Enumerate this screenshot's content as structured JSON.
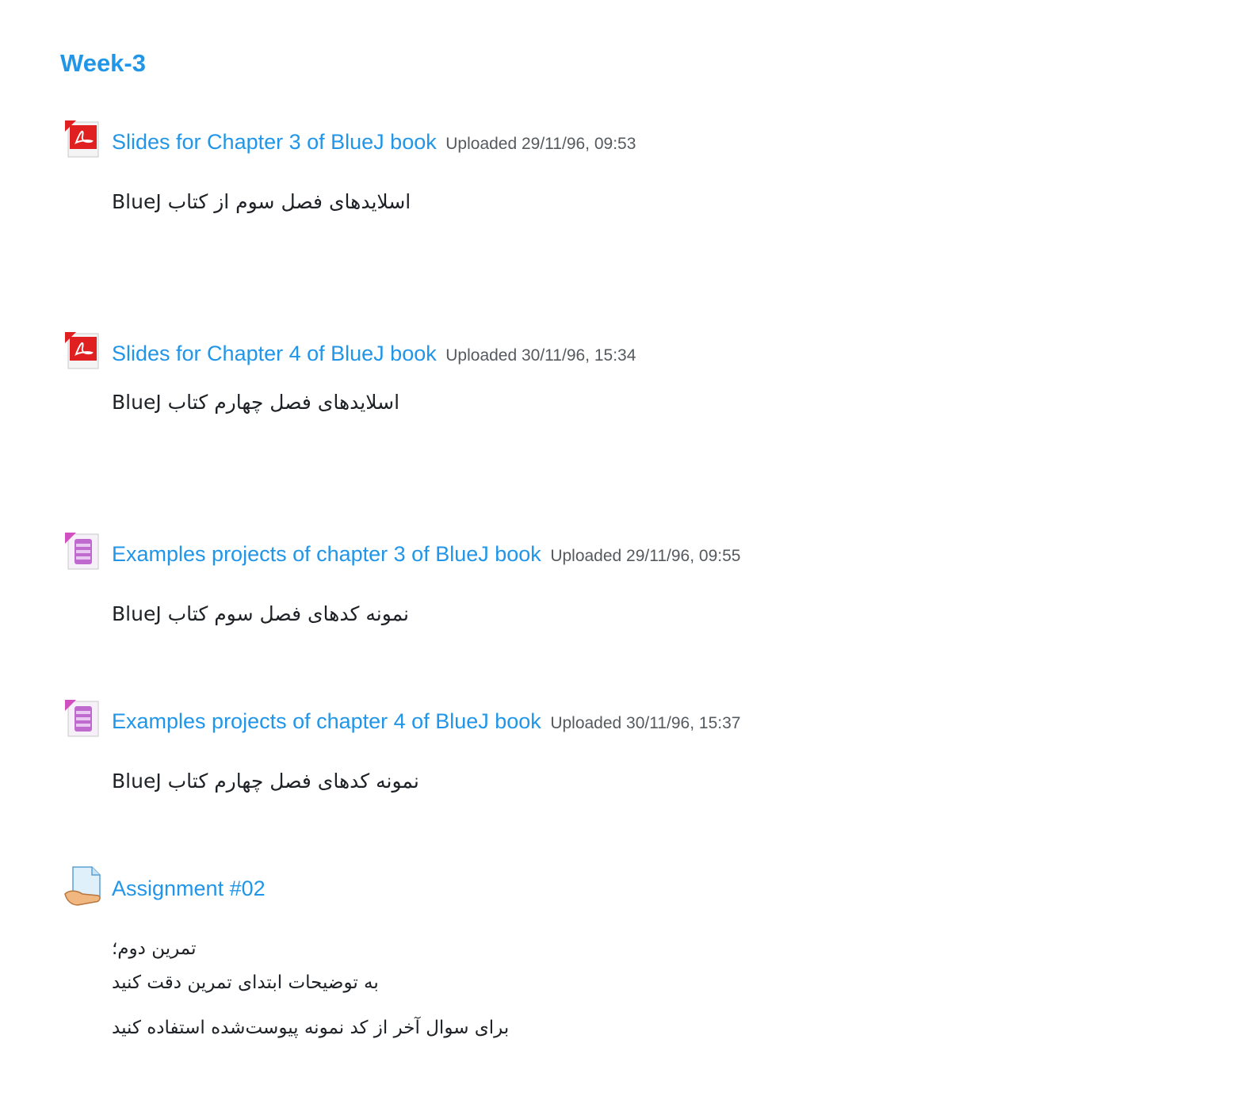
{
  "section": {
    "title": "Week-3"
  },
  "activities": [
    {
      "type_icon": "pdf-icon",
      "title": "Slides for Chapter 3 of BlueJ book",
      "uploaded": "Uploaded 29/11/96, 09:53",
      "description": "اسلایدهای فصل سوم از کتاب BlueJ"
    },
    {
      "type_icon": "pdf-icon",
      "title": "Slides for Chapter 4 of BlueJ book",
      "uploaded": "Uploaded 30/11/96, 15:34",
      "description": "اسلایدهای فصل چهارم کتاب BlueJ"
    },
    {
      "type_icon": "archive-icon",
      "title": "Examples projects of chapter 3 of BlueJ book",
      "uploaded": "Uploaded 29/11/96, 09:55",
      "description": "نمونه کدهای فصل سوم کتاب BlueJ"
    },
    {
      "type_icon": "archive-icon",
      "title": "Examples projects of chapter 4 of BlueJ book",
      "uploaded": "Uploaded 30/11/96, 15:37",
      "description": "نمونه کدهای فصل چهارم کتاب BlueJ"
    },
    {
      "type_icon": "assignment-icon",
      "title": "Assignment #02",
      "description_lines": [
        "تمرین دوم؛",
        "به توضیحات ابتدای تمرین دقت کنید",
        "برای سوال آخر از کد نمونه پیوست‌شده استفاده کنید"
      ]
    }
  ],
  "colors": {
    "link": "#2196e8",
    "meta": "#555a5e",
    "text": "#1d2125"
  }
}
